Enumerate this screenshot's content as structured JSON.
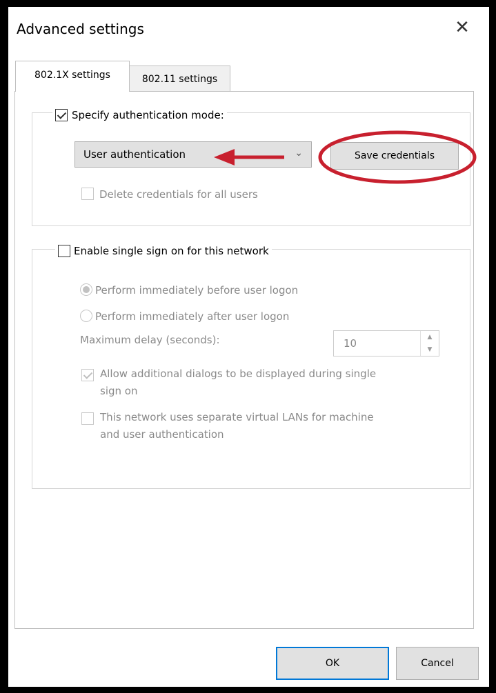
{
  "dialog": {
    "title": "Advanced settings",
    "close_glyph": "✕"
  },
  "tabs": [
    {
      "label": "802.1X settings",
      "active": true
    },
    {
      "label": "802.11 settings",
      "active": false
    }
  ],
  "auth_group": {
    "specify_label": "Specify authentication mode:",
    "specify_checked": true,
    "mode_value": "User authentication",
    "save_credentials_label": "Save credentials",
    "delete_label": "Delete credentials for all users",
    "delete_checked": false
  },
  "sso_group": {
    "enable_label": "Enable single sign on for this network",
    "enable_checked": false,
    "radio_before_label": "Perform immediately before user logon",
    "radio_after_label": "Perform immediately after user logon",
    "selected_radio": "before",
    "max_delay_label": "Maximum delay (seconds):",
    "max_delay_value": "10",
    "allow_dialogs_label_line1": "Allow additional dialogs to be displayed during single",
    "allow_dialogs_label_line2": "sign on",
    "allow_dialogs_checked": true,
    "vlan_label_line1": "This network uses separate virtual LANs for machine",
    "vlan_label_line2": "and user authentication",
    "vlan_checked": false
  },
  "footer": {
    "ok_label": "OK",
    "cancel_label": "Cancel"
  },
  "annotation": {
    "color": "#c8202e",
    "shapes": [
      "arrow",
      "ellipse"
    ]
  },
  "colors": {
    "frame": "#000000",
    "window_bg": "#ffffff",
    "button_bg": "#e1e1e1",
    "focus_border": "#0078d7",
    "disabled_text": "#8a8a8a"
  }
}
